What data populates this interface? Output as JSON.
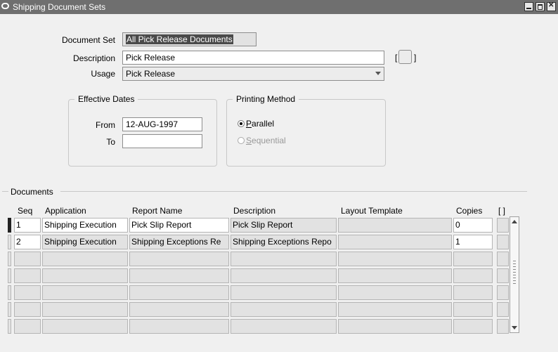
{
  "window": {
    "title": "Shipping Document Sets"
  },
  "form": {
    "document_set_label": "Document Set",
    "document_set_value": "All Pick Release Documents",
    "description_label": "Description",
    "description_value": "Pick Release",
    "usage_label": "Usage",
    "usage_value": "Pick Release",
    "bracket_left": "[",
    "bracket_right": "]"
  },
  "effective_dates": {
    "title": "Effective Dates",
    "from_label": "From",
    "from_value": "12-AUG-1997",
    "to_label": "To",
    "to_value": ""
  },
  "printing_method": {
    "title": "Printing Method",
    "parallel_label": "Parallel",
    "sequential_label": "Sequential",
    "selected": "Parallel"
  },
  "documents": {
    "title": "Documents",
    "columns": {
      "seq": "Seq",
      "application": "Application",
      "report_name": "Report Name",
      "description": "Description",
      "layout_template": "Layout Template",
      "copies": "Copies",
      "flex": "[ ]"
    },
    "rows": [
      {
        "seq": "1",
        "application": "Shipping Execution",
        "report_name": "Pick Slip Report",
        "description": "Pick Slip Report",
        "layout_template": "",
        "copies": "0"
      },
      {
        "seq": "2",
        "application": "Shipping Execution",
        "report_name": "Shipping Exceptions Re",
        "description": "Shipping Exceptions Repo",
        "layout_template": "",
        "copies": "1"
      }
    ]
  }
}
